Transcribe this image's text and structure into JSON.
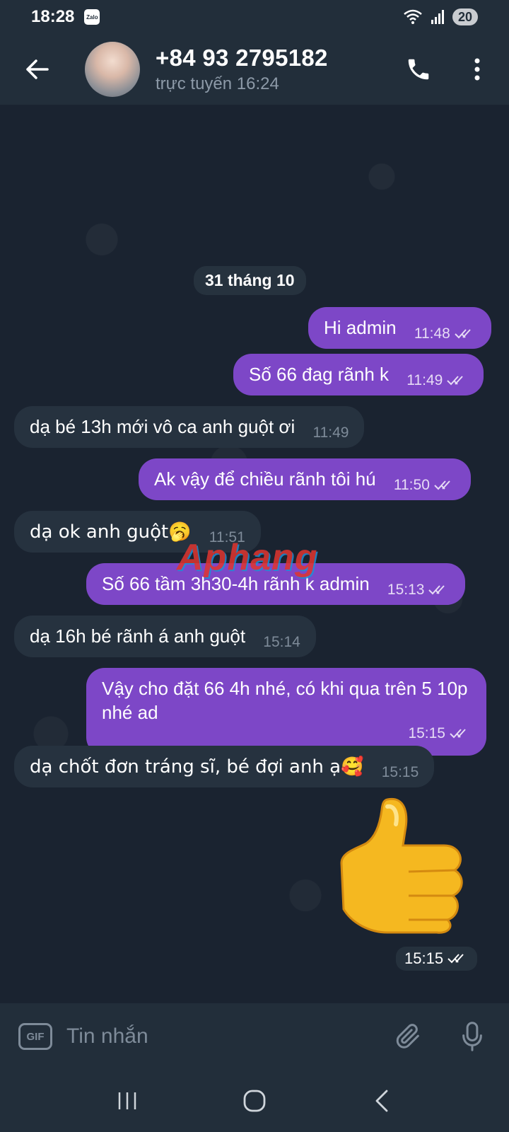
{
  "status_bar": {
    "time": "18:28",
    "app_badge": "Zalo",
    "battery": "20"
  },
  "header": {
    "contact_name": "+84 93 2795182",
    "contact_status": "trực tuyến 16:24"
  },
  "chat": {
    "date_label": "31 tháng 10",
    "messages": [
      {
        "dir": "out",
        "text": "Hi admin",
        "time": "11:48"
      },
      {
        "dir": "out",
        "text": "Số 66 đag rãnh k",
        "time": "11:49"
      },
      {
        "dir": "in",
        "text": "dạ bé 13h mới vô ca anh guột ơi",
        "time": "11:49"
      },
      {
        "dir": "out",
        "text": "Ak vậy để chiều rãnh tôi hú",
        "time": "11:50"
      },
      {
        "dir": "in",
        "text": "dạ ok anh guột🥱",
        "time": "11:51"
      },
      {
        "dir": "out",
        "text": "Số 66 tầm 3h30-4h rãnh k admin",
        "time": "15:13"
      },
      {
        "dir": "in",
        "text": "dạ 16h bé rãnh á anh guột",
        "time": "15:14"
      },
      {
        "dir": "out",
        "text": "Vậy cho đặt 66 4h nhé, có khi qua trên 5 10p nhé ad",
        "time": "15:15"
      },
      {
        "dir": "in",
        "text": "dạ chốt đơn tráng sĩ, bé đợi anh ạ🥰",
        "time": "15:15"
      }
    ],
    "sticker_time": "15:15",
    "watermark": "Aphang"
  },
  "input_bar": {
    "gif_label": "GIF",
    "placeholder": "Tin nhắn"
  },
  "colors": {
    "outgoing_bubble": "#7d47c7",
    "incoming_bubble": "#26323f",
    "header_bg": "#222e3a"
  }
}
